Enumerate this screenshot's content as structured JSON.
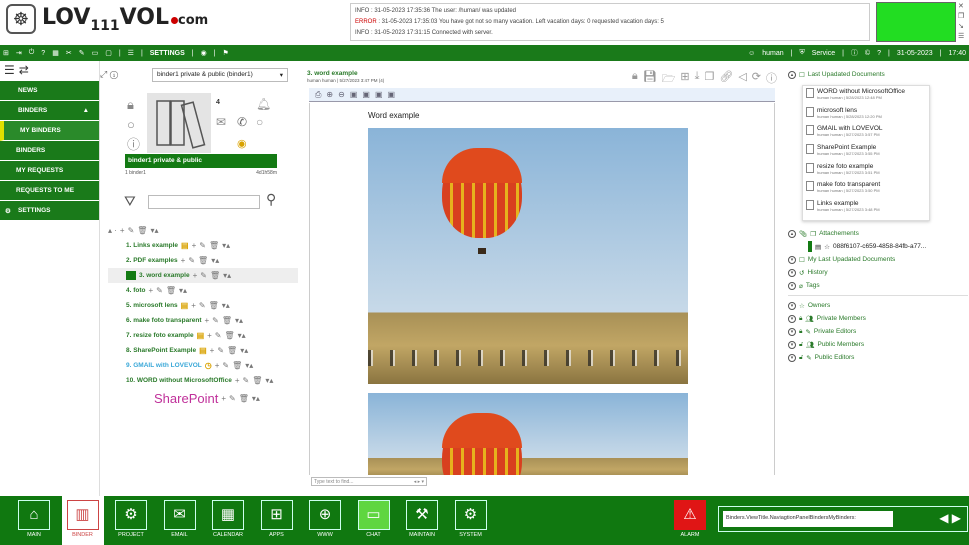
{
  "app": {
    "logo_text": "LOV111VOL.com"
  },
  "log": {
    "lines": [
      {
        "level": "INFO",
        "text": "INFO : 31-05-2023 17:35:36 The user: /human/ was updated"
      },
      {
        "level": "ERROR",
        "prefix": "ERROR",
        "text": " : 31-05-2023 17:35:03 You have got not so many vacation. Left vacation days:  0 requested vacation days:  5"
      },
      {
        "level": "INFO",
        "text": "INFO : 31-05-2023 17:31:15 Connected with server."
      }
    ]
  },
  "status_color": "#22dd22",
  "menubar": {
    "settings": "SETTINGS",
    "user": "human",
    "service": "Service",
    "date": "31-05-2023",
    "time": "17:40"
  },
  "sidebar": {
    "items": [
      {
        "label": "NEWS",
        "icon": "grid-icon"
      },
      {
        "label": "BINDERS",
        "icon": "binder-icon"
      },
      {
        "label": "MY BINDERS",
        "active": true
      },
      {
        "label": "BINDERS"
      },
      {
        "label": "MY REQUESTS"
      },
      {
        "label": "REQUESTS TO ME"
      },
      {
        "label": "SETTINGS",
        "icon": "gear-icon"
      }
    ]
  },
  "binder": {
    "selected": "binder1 private & public (binder1)",
    "count": "4",
    "name": "binder1 private & public",
    "meta_left": "1   binder1",
    "meta_right": "4d1h58m",
    "filter_value": ""
  },
  "tree": [
    {
      "label": "1. Links example",
      "note": true
    },
    {
      "label": "2. PDF examples"
    },
    {
      "label": "3. word example",
      "selected": true
    },
    {
      "label": "4. foto"
    },
    {
      "label": "5. microsoft lens",
      "note": true
    },
    {
      "label": "6. make foto transparent"
    },
    {
      "label": "7. resize foto example",
      "note": true
    },
    {
      "label": "8. SharePoint Example",
      "note": true
    },
    {
      "label": "9. GMAIL with LOVEVOL",
      "clock": true,
      "color": "#3aa8d8"
    },
    {
      "label": "10. WORD without MicrosoftOffice"
    },
    {
      "label": "SharePoint",
      "big": true,
      "color": "#c0309a"
    }
  ],
  "document": {
    "title": "3. word example",
    "meta": "human human | 5/27/2023 3:47 PM (4)",
    "heading": "Word example",
    "find_placeholder": "Type text to find..."
  },
  "right": {
    "last_updated_title": "Last Upadated Documents",
    "last_updated": [
      {
        "name": "WORD without MicrosoftOffice",
        "meta": "human human | 5/28/2023 12:48 PM"
      },
      {
        "name": "microsoft lens",
        "meta": "human human | 5/28/2023 12:20 PM"
      },
      {
        "name": "GMAIL with LOVEVOL",
        "meta": "human human | 5/27/2023 3:57 PM"
      },
      {
        "name": "SharePoint Example",
        "meta": "human human | 5/27/2023 3:55 PM"
      },
      {
        "name": "resize foto example",
        "meta": "human human | 5/27/2023 3:51 PM"
      },
      {
        "name": "make foto transparent",
        "meta": "human human | 5/27/2023 3:50 PM"
      },
      {
        "name": "Links example",
        "meta": "human human | 5/27/2023 3:48 PM"
      }
    ],
    "attachments": "Attachements",
    "attachment_file": "088f6107-c659-4858-84fb-a77...",
    "sections": [
      "My Last Upadated Documents",
      "History",
      "Tags"
    ],
    "members": [
      "Owners",
      "Private Members",
      "Private Editors",
      "Public Members",
      "Public Editors"
    ]
  },
  "bottom": {
    "buttons": [
      "MAIN",
      "BINDER",
      "PROJECT",
      "EMAIL",
      "CALENDAR",
      "APPS",
      "WWW",
      "CHAT",
      "MAINTAIN",
      "SYSTEM"
    ],
    "alarm": "ALARM",
    "nav_path": "Binders.ViewTitle.NaviagtionPanelBindersMyBinders:"
  }
}
